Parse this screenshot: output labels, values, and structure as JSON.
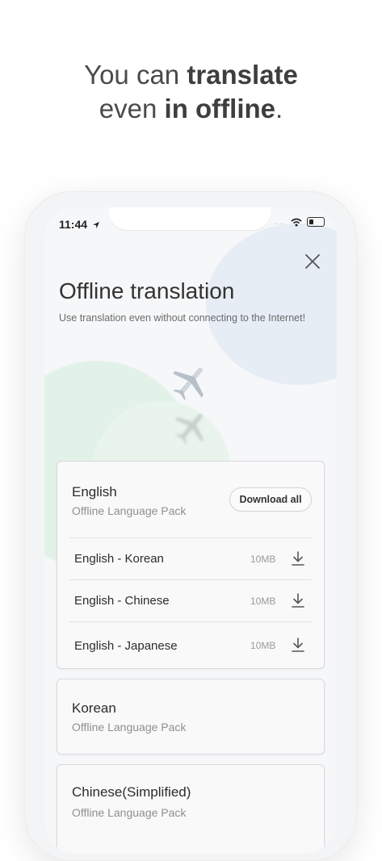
{
  "headline": {
    "line1_prefix": "You can ",
    "line1_bold": "translate",
    "line2_prefix": "even ",
    "line2_bold": "in offline",
    "line2_suffix": "."
  },
  "status_bar": {
    "time": "11:44",
    "signal": "...."
  },
  "screen": {
    "title": "Offline translation",
    "subtitle": "Use translation even without connecting to the Internet!"
  },
  "cards": [
    {
      "name": "English",
      "sub": "Offline Language Pack",
      "download_all_label": "Download all",
      "packs": [
        {
          "name": "English - Korean",
          "size": "10MB"
        },
        {
          "name": "English - Chinese",
          "size": "10MB"
        },
        {
          "name": "English - Japanese",
          "size": "10MB"
        }
      ]
    },
    {
      "name": "Korean",
      "sub": "Offline Language Pack"
    },
    {
      "name": "Chinese(Simplified)",
      "sub": "Offline Language Pack"
    }
  ],
  "icons": {
    "close": "close-icon",
    "download": "download-icon",
    "plane": "airplane-icon",
    "location": "location-arrow-icon",
    "wifi": "wifi-icon",
    "battery": "battery-icon"
  },
  "colors": {
    "background": "#ffffff",
    "screen": "#f6f7f8",
    "green_blob": "#e3f2e8",
    "blue_blob": "#e6edf4"
  }
}
